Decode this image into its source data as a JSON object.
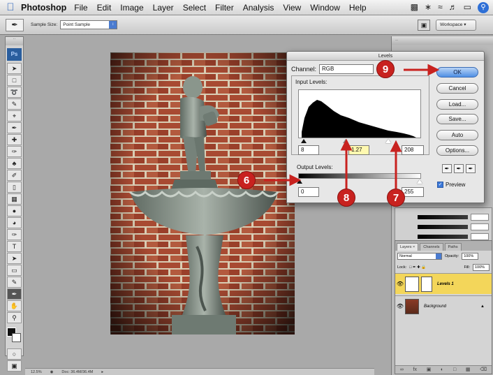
{
  "menubar": {
    "app": "Photoshop",
    "items": [
      "File",
      "Edit",
      "Image",
      "Layer",
      "Select",
      "Filter",
      "Analysis",
      "View",
      "Window",
      "Help"
    ]
  },
  "options": {
    "sample_size_label": "Sample Size:",
    "sample_size_value": "Point Sample",
    "workspace_label": "Workspace ▾"
  },
  "tools": {
    "ps_logo": "Ps",
    "icons": [
      "move-icon",
      "marquee-icon",
      "lasso-icon",
      "quick-select-icon",
      "crop-icon",
      "eyedropper-icon",
      "healing-icon",
      "brush-icon",
      "stamp-icon",
      "history-brush-icon",
      "eraser-icon",
      "gradient-icon",
      "blur-icon",
      "dodge-icon",
      "pen-icon",
      "type-icon",
      "path-select-icon",
      "shape-icon",
      "notes-icon",
      "eyedropper-2-icon",
      "hand-icon",
      "zoom-icon"
    ]
  },
  "levels": {
    "title": "Levels",
    "channel_label": "Channel:",
    "channel_value": "RGB",
    "input_label": "Input Levels:",
    "input_black": "8",
    "input_gamma": "1.27",
    "input_white": "208",
    "output_label": "Output Levels:",
    "output_black": "0",
    "output_white": "255",
    "buttons": {
      "ok": "OK",
      "cancel": "Cancel",
      "load": "Load...",
      "save": "Save...",
      "auto": "Auto",
      "options": "Options..."
    },
    "preview_label": "Preview"
  },
  "callouts": {
    "c6": "6",
    "c7": "7",
    "c8": "8",
    "c9": "9"
  },
  "layers": {
    "tabs": [
      "Layers ×",
      "Channels",
      "Paths"
    ],
    "blend_mode": "Normal",
    "opacity_label": "Opacity:",
    "opacity_value": "100%",
    "lock_label": "Lock:",
    "fill_label": "Fill:",
    "fill_value": "100%",
    "items": [
      {
        "name": "Levels 1"
      },
      {
        "name": "Background"
      }
    ]
  },
  "status": {
    "zoom": "12.5%",
    "doc": "Doc: 36.4M/36.4M"
  },
  "colors": {
    "callout_red": "#c8221f",
    "selected_layer": "#f3d65a",
    "ok_blue": "#4f8fe4"
  }
}
